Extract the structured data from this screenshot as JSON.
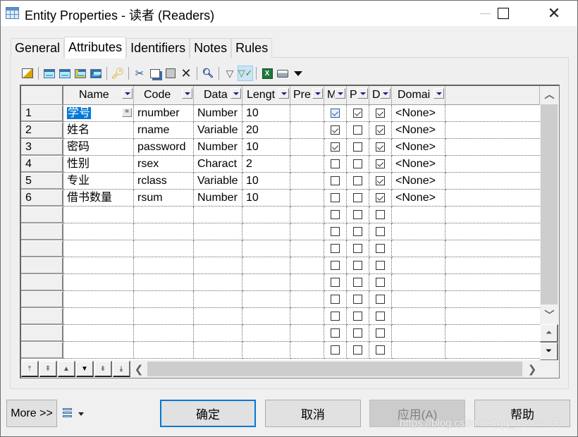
{
  "window": {
    "title": "Entity Properties - 读者 (Readers)",
    "controls": {
      "minimize": "—",
      "maximize": "☐",
      "close": "✕"
    }
  },
  "tabs": [
    {
      "label": "General",
      "active": false
    },
    {
      "label": "Attributes",
      "active": true
    },
    {
      "label": "Identifiers",
      "active": false
    },
    {
      "label": "Notes",
      "active": false
    },
    {
      "label": "Rules",
      "active": false
    }
  ],
  "toolbar": {
    "items": [
      "properties-icon",
      "separator",
      "insert-row-icon",
      "add-row-icon",
      "add-attributes-icon",
      "reuse-attributes-icon",
      "separator",
      "identifier-key-icon",
      "separator",
      "cut-icon",
      "copy-icon",
      "paste-icon",
      "delete-icon",
      "separator",
      "find-icon",
      "separator",
      "customize-filter-icon",
      "filter-icon",
      "separator",
      "export-excel-icon",
      "print-icon",
      "more-dropdown-icon"
    ],
    "active_item": "filter-icon"
  },
  "grid": {
    "columns": [
      {
        "key": "name",
        "label": "Name"
      },
      {
        "key": "code",
        "label": "Code"
      },
      {
        "key": "data",
        "label": "Data"
      },
      {
        "key": "length",
        "label": "Lengt"
      },
      {
        "key": "precision",
        "label": "Pre"
      },
      {
        "key": "m",
        "label": "M"
      },
      {
        "key": "p",
        "label": "P"
      },
      {
        "key": "d",
        "label": "D"
      },
      {
        "key": "domain",
        "label": "Domai"
      }
    ],
    "rows": [
      {
        "num": "1",
        "name": "学号",
        "code": "rnumber",
        "data": "Number",
        "length": "10",
        "precision": "",
        "m": true,
        "p": true,
        "d": true,
        "domain": "<None>",
        "selected": true
      },
      {
        "num": "2",
        "name": "姓名",
        "code": "rname",
        "data": "Variable",
        "length": "20",
        "precision": "",
        "m": true,
        "p": false,
        "d": true,
        "domain": "<None>"
      },
      {
        "num": "3",
        "name": "密码",
        "code": "password",
        "data": "Number",
        "length": "10",
        "precision": "",
        "m": true,
        "p": false,
        "d": true,
        "domain": "<None>"
      },
      {
        "num": "4",
        "name": "性别",
        "code": "rsex",
        "data": "Charact",
        "length": "2",
        "precision": "",
        "m": false,
        "p": false,
        "d": true,
        "domain": "<None>"
      },
      {
        "num": "5",
        "name": "专业",
        "code": "rclass",
        "data": "Variable",
        "length": "10",
        "precision": "",
        "m": false,
        "p": false,
        "d": true,
        "domain": "<None>"
      },
      {
        "num": "6",
        "name": "借书数量",
        "code": "rsum",
        "data": "Number",
        "length": "10",
        "precision": "",
        "m": false,
        "p": false,
        "d": true,
        "domain": "<None>"
      }
    ],
    "empty_rows": 9,
    "nav_buttons": [
      "move-top",
      "move-page-up",
      "move-up",
      "move-down",
      "move-page-down",
      "move-bottom"
    ]
  },
  "footer": {
    "more_label": "More >>",
    "ok_label": "确定",
    "cancel_label": "取消",
    "apply_label": "应用(A)",
    "help_label": "帮助",
    "watermark": "https://blog.csdn.net/qq_45664450"
  }
}
